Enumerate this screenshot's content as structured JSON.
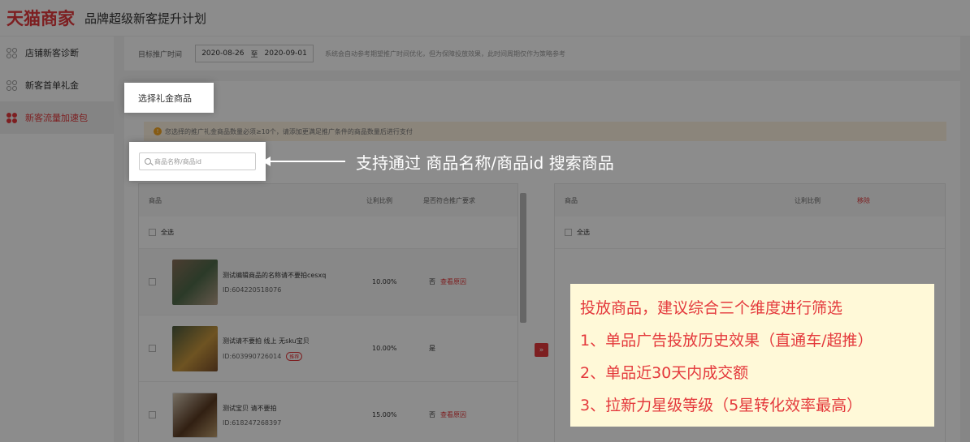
{
  "header": {
    "logo": "天猫商家",
    "title": "品牌超级新客提升计划"
  },
  "sidebar": {
    "items": [
      {
        "label": "店铺新客诊断",
        "active": false
      },
      {
        "label": "新客首单礼金",
        "active": false
      },
      {
        "label": "新客流量加速包",
        "active": true
      }
    ]
  },
  "date_card": {
    "label": "目标推广时间",
    "start": "2020-08-26",
    "separator": "至",
    "end": "2020-09-01",
    "note": "系统会自动参考期望推广时间优化，但为保障投放效果，此时间周期仅作为策略参考"
  },
  "tab_label": "选择礼金商品",
  "warning": "您选择的推广礼金商品数量必须≥10个，请添加更满足推广条件的商品数量后进行支付",
  "search": {
    "placeholder": "商品名称/商品id"
  },
  "annotation": "支持通过 商品名称/商品id 搜索商品",
  "left_table": {
    "headers": {
      "product": "商品",
      "ratio": "让利比例",
      "meet": "是否符合推广要求"
    },
    "select_all": "全选",
    "rows": [
      {
        "name": "测试编辑商品的名称请不要拍cesxq",
        "id": "ID:604220518076",
        "badge": "",
        "ratio": "10.00%",
        "meet": "否",
        "reason": "查看原因"
      },
      {
        "name": "测试请不要拍 线上 无sku宝贝",
        "id": "ID:603990726014",
        "badge": "推荐",
        "ratio": "10.00%",
        "meet": "是",
        "reason": ""
      },
      {
        "name": "测试宝贝 请不要拍",
        "id": "ID:618247268397",
        "badge": "",
        "ratio": "15.00%",
        "meet": "否",
        "reason": "查看原因"
      }
    ]
  },
  "transfer_button": "»",
  "right_table": {
    "headers": {
      "product": "商品",
      "ratio": "让利比例",
      "delete": "移除"
    },
    "select_all": "全选"
  },
  "tip_box": {
    "lines": [
      "投放商品，建议综合三个维度进行筛选",
      "1、单品广告投放历史效果（直通车/超推）",
      "2、单品近30天内成交额",
      "3、拉新力星级等级（5星转化效率最高）"
    ]
  },
  "colors": {
    "brand": "#e4393c",
    "tip_bg": "#fff9d8",
    "warning_bg": "#fdf2e0"
  }
}
